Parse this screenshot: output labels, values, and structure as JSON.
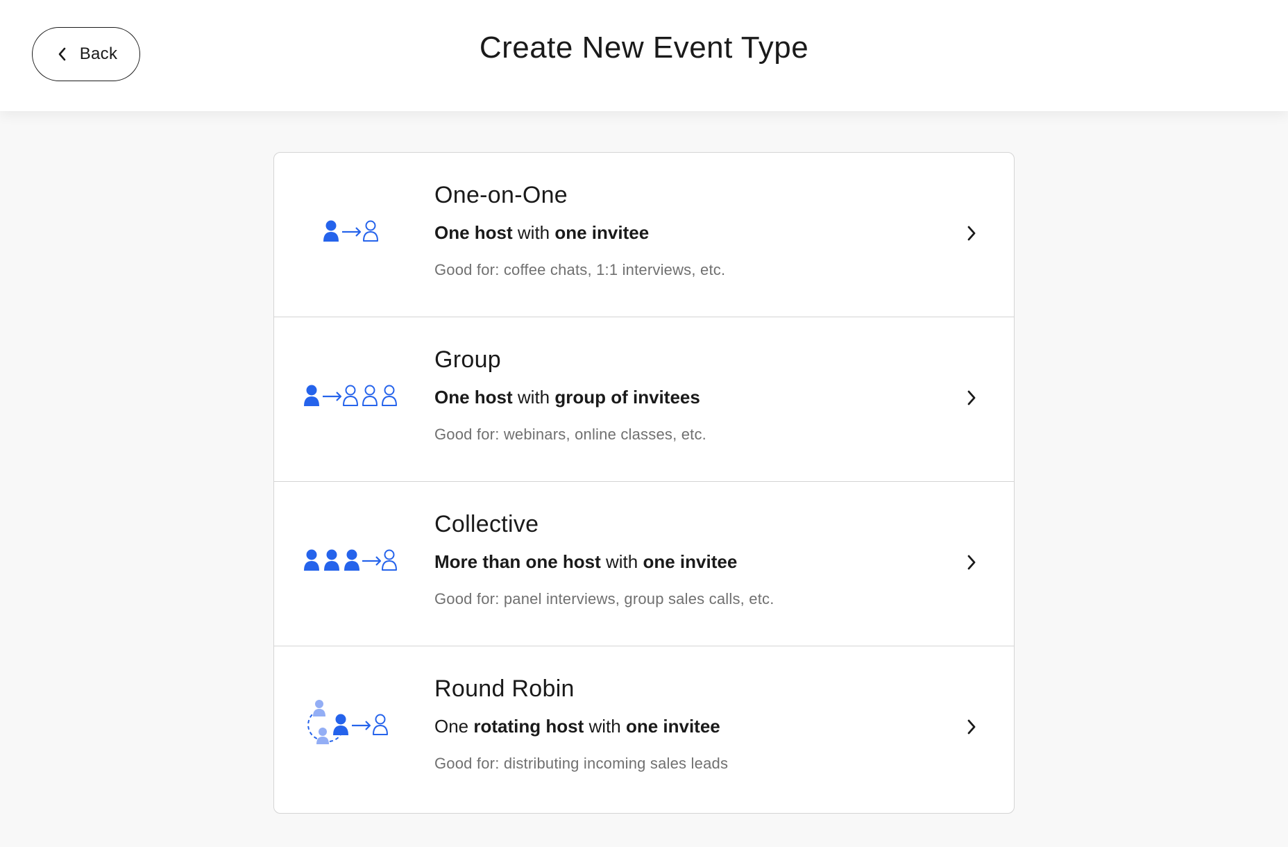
{
  "header": {
    "back_label": "Back",
    "title": "Create New Event Type"
  },
  "colors": {
    "accent": "#2563eb",
    "accent_light": "#93aef5",
    "text": "#1a1a1a",
    "muted": "#707070",
    "border": "#d4d4d4",
    "page_bg": "#f8f8f8"
  },
  "options": [
    {
      "title": "One-on-One",
      "desc": [
        {
          "text": "One host",
          "bold": true
        },
        {
          "text": " with ",
          "bold": false
        },
        {
          "text": "one invitee",
          "bold": true
        }
      ],
      "good_for": "Good for: coffee chats, 1:1 interviews, etc.",
      "icon": "one-on-one-icon"
    },
    {
      "title": "Group",
      "desc": [
        {
          "text": "One host",
          "bold": true
        },
        {
          "text": " with ",
          "bold": false
        },
        {
          "text": "group of invitees",
          "bold": true
        }
      ],
      "good_for": "Good for: webinars, online classes, etc.",
      "icon": "group-icon"
    },
    {
      "title": "Collective",
      "desc": [
        {
          "text": "More than one host",
          "bold": true
        },
        {
          "text": " with ",
          "bold": false
        },
        {
          "text": "one invitee",
          "bold": true
        }
      ],
      "good_for": "Good for: panel interviews, group sales calls, etc.",
      "icon": "collective-icon"
    },
    {
      "title": "Round Robin",
      "desc": [
        {
          "text": "One ",
          "bold": false
        },
        {
          "text": "rotating host",
          "bold": true
        },
        {
          "text": " with ",
          "bold": false
        },
        {
          "text": "one invitee",
          "bold": true
        }
      ],
      "good_for": "Good for: distributing incoming sales leads",
      "icon": "round-robin-icon"
    }
  ]
}
